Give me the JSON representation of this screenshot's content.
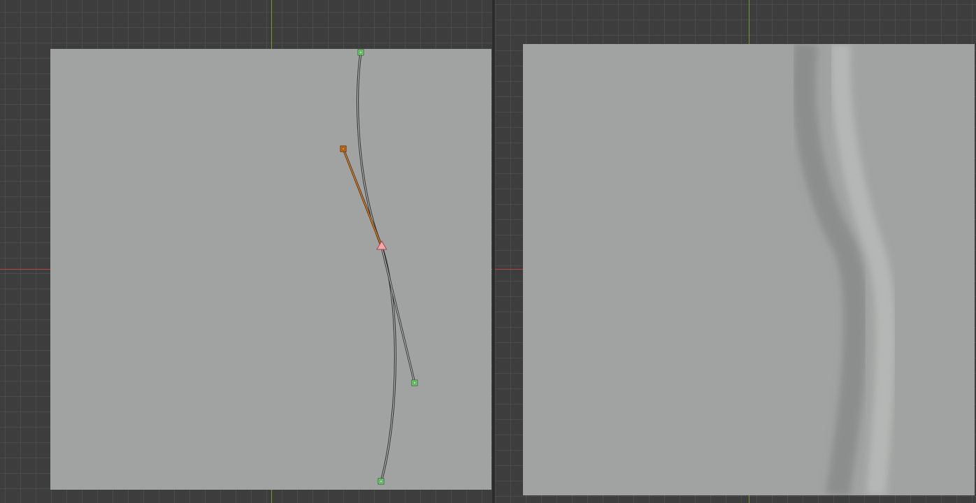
{
  "app": {
    "theme": "dark-grid"
  },
  "viewports": {
    "left": {
      "kind": "curve-editor",
      "background": "#a1a3a2"
    },
    "right": {
      "kind": "texture-preview",
      "background": "#a1a3a2"
    }
  },
  "curve": {
    "color": "#2d2d2d",
    "points": [
      {
        "name": "curve-point-top",
        "type": "endpoint",
        "color": "#9fef9f"
      },
      {
        "name": "tangent-handle-upper",
        "type": "handle",
        "color": "#f08a2a",
        "selected": true
      },
      {
        "name": "curve-point-middle",
        "type": "pivot",
        "color": "#f0a8a8"
      },
      {
        "name": "tangent-handle-lower",
        "type": "handle",
        "color": "#9fef9f"
      },
      {
        "name": "curve-point-bottom",
        "type": "endpoint",
        "color": "#9fef9f"
      }
    ]
  },
  "colors": {
    "axis_x": "#b04646",
    "axis_y": "#7a9a2a",
    "grid_bg": "#3d3d3d",
    "groove_dark": "#8c8e8d",
    "groove_light": "#b5b7b6",
    "selection": "#f08a2a"
  }
}
